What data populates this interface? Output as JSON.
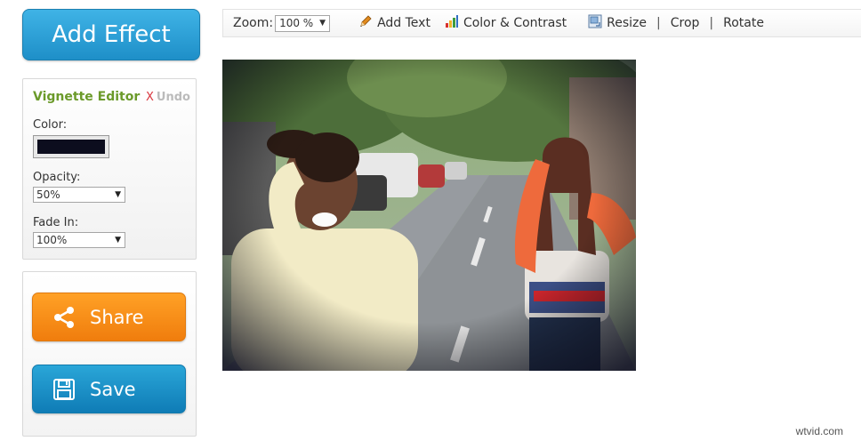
{
  "left_panel": {
    "add_effect_label": "Add Effect",
    "editor": {
      "title": "Vignette Editor",
      "undo_x": "X",
      "undo_label": "Undo",
      "color_label": "Color:",
      "color_value": "#0c0d1e",
      "opacity_label": "Opacity:",
      "opacity_value": "50%",
      "fade_label": "Fade In:",
      "fade_value": "100%"
    },
    "share_label": "Share",
    "save_label": "Save"
  },
  "toolbar": {
    "zoom_label": "Zoom:",
    "zoom_value": "100 %",
    "add_text": "Add Text",
    "color_contrast": "Color & Contrast",
    "resize": "Resize",
    "crop": "Crop",
    "rotate": "Rotate",
    "separator": "|"
  },
  "watermark": "wtvid.com",
  "colors": {
    "accent_blue": "#1e8fc8",
    "accent_orange": "#f07d0d",
    "title_green": "#6b9a2a",
    "undo_red": "#d9363e"
  },
  "icons": [
    "share-icon",
    "save-icon",
    "pencil-icon",
    "color-bars-icon",
    "resize-icon",
    "chevron-down-icon"
  ]
}
